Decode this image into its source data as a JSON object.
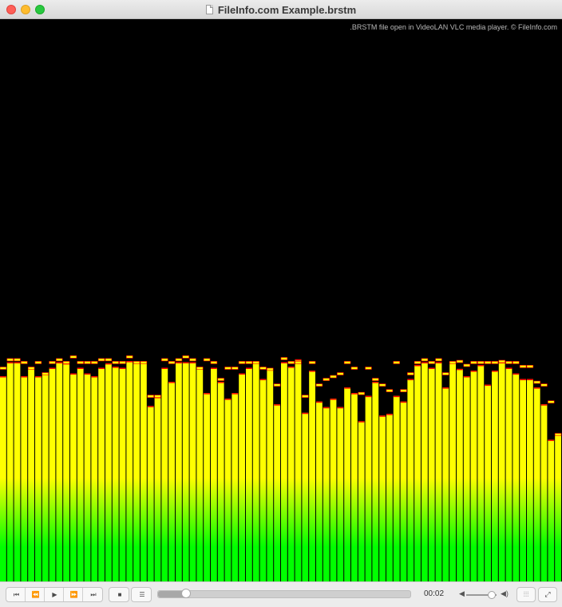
{
  "window": {
    "title": "FileInfo.com Example.brstm"
  },
  "video": {
    "caption": ".BRSTM file open in VideoLAN VLC media player. © FileInfo.com",
    "visualization": {
      "band_levels": [
        0.365,
        0.39,
        0.39,
        0.365,
        0.38,
        0.365,
        0.37,
        0.38,
        0.39,
        0.388,
        0.37,
        0.38,
        0.37,
        0.365,
        0.38,
        0.388,
        0.382,
        0.38,
        0.392,
        0.39,
        0.39,
        0.312,
        0.328,
        0.38,
        0.355,
        0.39,
        0.39,
        0.39,
        0.38,
        0.335,
        0.38,
        0.355,
        0.325,
        0.335,
        0.37,
        0.38,
        0.39,
        0.36,
        0.378,
        0.315,
        0.39,
        0.382,
        0.395,
        0.3,
        0.375,
        0.32,
        0.31,
        0.325,
        0.31,
        0.345,
        0.335,
        0.285,
        0.33,
        0.355,
        0.295,
        0.298,
        0.33,
        0.32,
        0.36,
        0.385,
        0.39,
        0.38,
        0.39,
        0.345,
        0.39,
        0.378,
        0.365,
        0.375,
        0.385,
        0.35,
        0.375,
        0.39,
        0.38,
        0.37,
        0.36,
        0.36,
        0.345,
        0.315,
        0.252,
        0.262
      ],
      "peak_levels": [
        0.38,
        0.395,
        0.395,
        0.39,
        0.38,
        0.39,
        0.37,
        0.39,
        0.395,
        0.39,
        0.4,
        0.39,
        0.39,
        0.39,
        0.395,
        0.395,
        0.39,
        0.39,
        0.4,
        0.39,
        0.39,
        0.33,
        0.33,
        0.395,
        0.39,
        0.395,
        0.4,
        0.395,
        0.38,
        0.395,
        0.39,
        0.36,
        0.38,
        0.38,
        0.39,
        0.39,
        0.39,
        0.38,
        0.378,
        0.35,
        0.397,
        0.39,
        0.39,
        0.33,
        0.39,
        0.35,
        0.36,
        0.365,
        0.37,
        0.39,
        0.38,
        0.335,
        0.38,
        0.36,
        0.35,
        0.34,
        0.39,
        0.34,
        0.37,
        0.39,
        0.395,
        0.39,
        0.395,
        0.37,
        0.39,
        0.392,
        0.385,
        0.39,
        0.39,
        0.39,
        0.39,
        0.392,
        0.39,
        0.39,
        0.383,
        0.383,
        0.355,
        0.35,
        0.32,
        0.262
      ],
      "colors": {
        "bar_top": "#ffff00",
        "bar_bottom": "#00ff00",
        "peak": "#ff0000",
        "background": "#000000"
      }
    }
  },
  "controls": {
    "buttons": {
      "previous": "⏮",
      "rewind": "⏪",
      "play": "▶",
      "fast_forward": "⏩",
      "next": "⏭",
      "stop": "■",
      "playlist": "☰"
    },
    "position": 0.11,
    "elapsed_time": "00:02",
    "volume": 0.85,
    "icons": {
      "volume_low": "🔈",
      "volume_high": "🔊",
      "equalizer": "⫶",
      "fullscreen": "⤢"
    }
  }
}
